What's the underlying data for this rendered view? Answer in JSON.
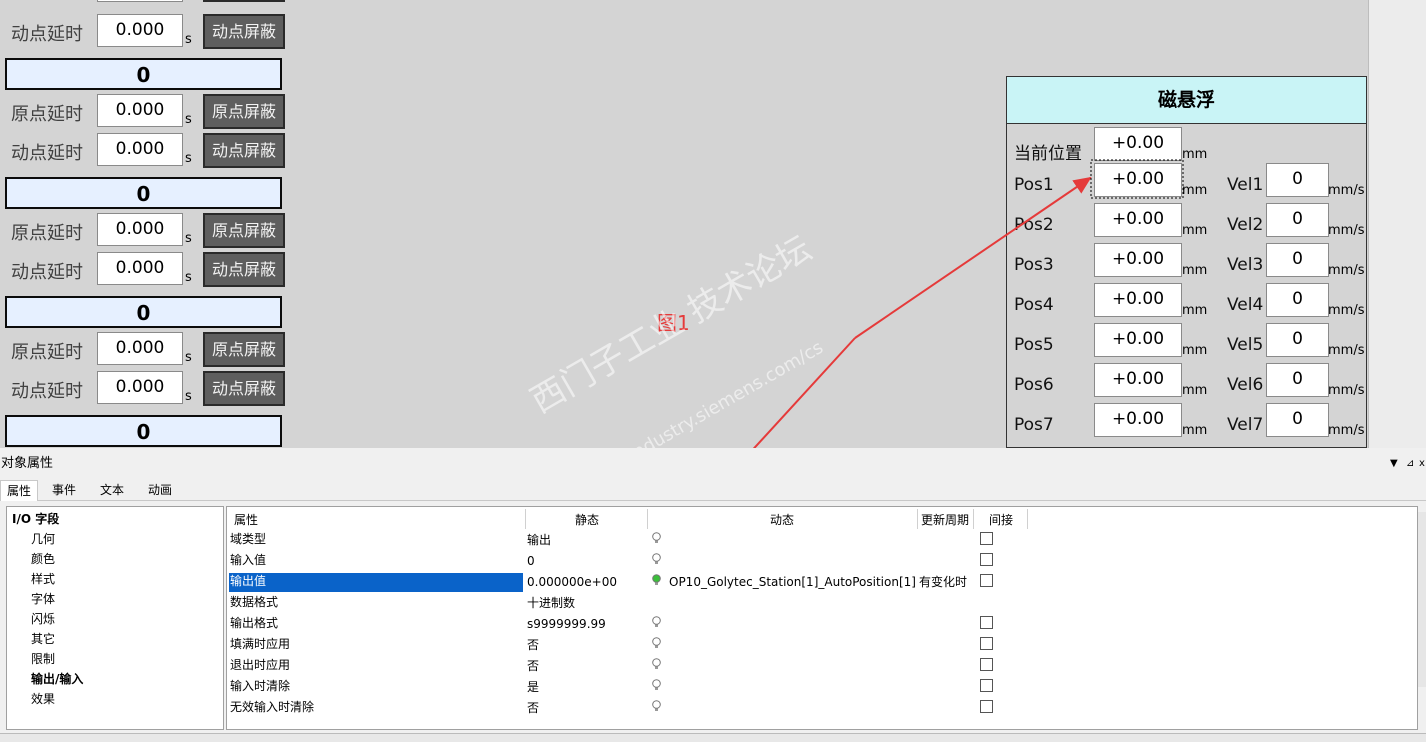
{
  "left_blocks": {
    "top_partial": {
      "label": "动点延时",
      "value": "0.000",
      "unit": "s",
      "button": "动点屏蔽"
    },
    "blocks": [
      {
        "header": "0",
        "rows": [
          {
            "label": "原点延时",
            "value": "0.000",
            "unit": "s",
            "button": "原点屏蔽"
          },
          {
            "label": "动点延时",
            "value": "0.000",
            "unit": "s",
            "button": "动点屏蔽"
          }
        ]
      },
      {
        "header": "0",
        "rows": [
          {
            "label": "原点延时",
            "value": "0.000",
            "unit": "s",
            "button": "原点屏蔽"
          },
          {
            "label": "动点延时",
            "value": "0.000",
            "unit": "s",
            "button": "动点屏蔽"
          }
        ]
      },
      {
        "header": "0",
        "rows": [
          {
            "label": "原点延时",
            "value": "0.000",
            "unit": "s",
            "button": "原点屏蔽"
          },
          {
            "label": "动点延时",
            "value": "0.000",
            "unit": "s",
            "button": "动点屏蔽"
          }
        ]
      },
      {
        "header": "0",
        "rows": []
      }
    ]
  },
  "maglev_panel": {
    "title": "磁悬浮",
    "current_position": {
      "label": "当前位置",
      "value": "+0.00",
      "unit": "mm"
    },
    "rows": [
      {
        "pos_label": "Pos1",
        "pos_value": "+0.00",
        "pos_unit": "mm",
        "vel_label": "Vel1",
        "vel_value": "0",
        "vel_unit": "mm/s"
      },
      {
        "pos_label": "Pos2",
        "pos_value": "+0.00",
        "pos_unit": "mm",
        "vel_label": "Vel2",
        "vel_value": "0",
        "vel_unit": "mm/s"
      },
      {
        "pos_label": "Pos3",
        "pos_value": "+0.00",
        "pos_unit": "mm",
        "vel_label": "Vel3",
        "vel_value": "0",
        "vel_unit": "mm/s"
      },
      {
        "pos_label": "Pos4",
        "pos_value": "+0.00",
        "pos_unit": "mm",
        "vel_label": "Vel4",
        "vel_value": "0",
        "vel_unit": "mm/s"
      },
      {
        "pos_label": "Pos5",
        "pos_value": "+0.00",
        "pos_unit": "mm",
        "vel_label": "Vel5",
        "vel_value": "0",
        "vel_unit": "mm/s"
      },
      {
        "pos_label": "Pos6",
        "pos_value": "+0.00",
        "pos_unit": "mm",
        "vel_label": "Vel6",
        "vel_value": "0",
        "vel_unit": "mm/s"
      },
      {
        "pos_label": "Pos7",
        "pos_value": "+0.00",
        "pos_unit": "mm",
        "vel_label": "Vel7",
        "vel_value": "0",
        "vel_unit": "mm/s"
      }
    ]
  },
  "annotation": {
    "figure_label": "图1",
    "color": "#e53a3a"
  },
  "watermark": {
    "line1": "西门子工业 技术论坛",
    "line2": "support.industry.siemens.com/cs"
  },
  "properties_window": {
    "title": "对象属性",
    "tabs": [
      "属性",
      "事件",
      "文本",
      "动画"
    ],
    "active_tab": "属性",
    "tree": {
      "root": "I/O 字段",
      "items": [
        "几何",
        "颜色",
        "样式",
        "字体",
        "闪烁",
        "其它",
        "限制",
        "输出/输入",
        "效果"
      ],
      "selected": "输出/输入"
    },
    "grid": {
      "columns": [
        "属性",
        "静态",
        "动态",
        "更新周期",
        "间接"
      ],
      "rows": [
        {
          "name": "域类型",
          "static": "输出",
          "dynamic": "",
          "cycle": "",
          "bulb": "gray",
          "indirect": true
        },
        {
          "name": "输入值",
          "static": "0",
          "dynamic": "",
          "cycle": "",
          "bulb": "gray",
          "indirect": true
        },
        {
          "name": "输出值",
          "static": "0.000000e+00",
          "dynamic": "OP10_Golytec_Station[1]_AutoPosition[1]",
          "cycle": "有变化时",
          "bulb": "green",
          "indirect": true,
          "selected": true
        },
        {
          "name": "数据格式",
          "static": "十进制数",
          "dynamic": "",
          "cycle": "",
          "bulb": "none",
          "indirect": false
        },
        {
          "name": "输出格式",
          "static": "s9999999.99",
          "dynamic": "",
          "cycle": "",
          "bulb": "gray",
          "indirect": true
        },
        {
          "name": "填满时应用",
          "static": "否",
          "dynamic": "",
          "cycle": "",
          "bulb": "gray",
          "indirect": true
        },
        {
          "name": "退出时应用",
          "static": "否",
          "dynamic": "",
          "cycle": "",
          "bulb": "gray",
          "indirect": true
        },
        {
          "name": "输入时清除",
          "static": "是",
          "dynamic": "",
          "cycle": "",
          "bulb": "gray",
          "indirect": true
        },
        {
          "name": "无效输入时清除",
          "static": "否",
          "dynamic": "",
          "cycle": "",
          "bulb": "gray",
          "indirect": true
        }
      ]
    },
    "controls": {
      "pin_icon": "pin-icon",
      "dropdown_icon": "chevron-down-icon",
      "close_icon": "close-icon"
    }
  }
}
